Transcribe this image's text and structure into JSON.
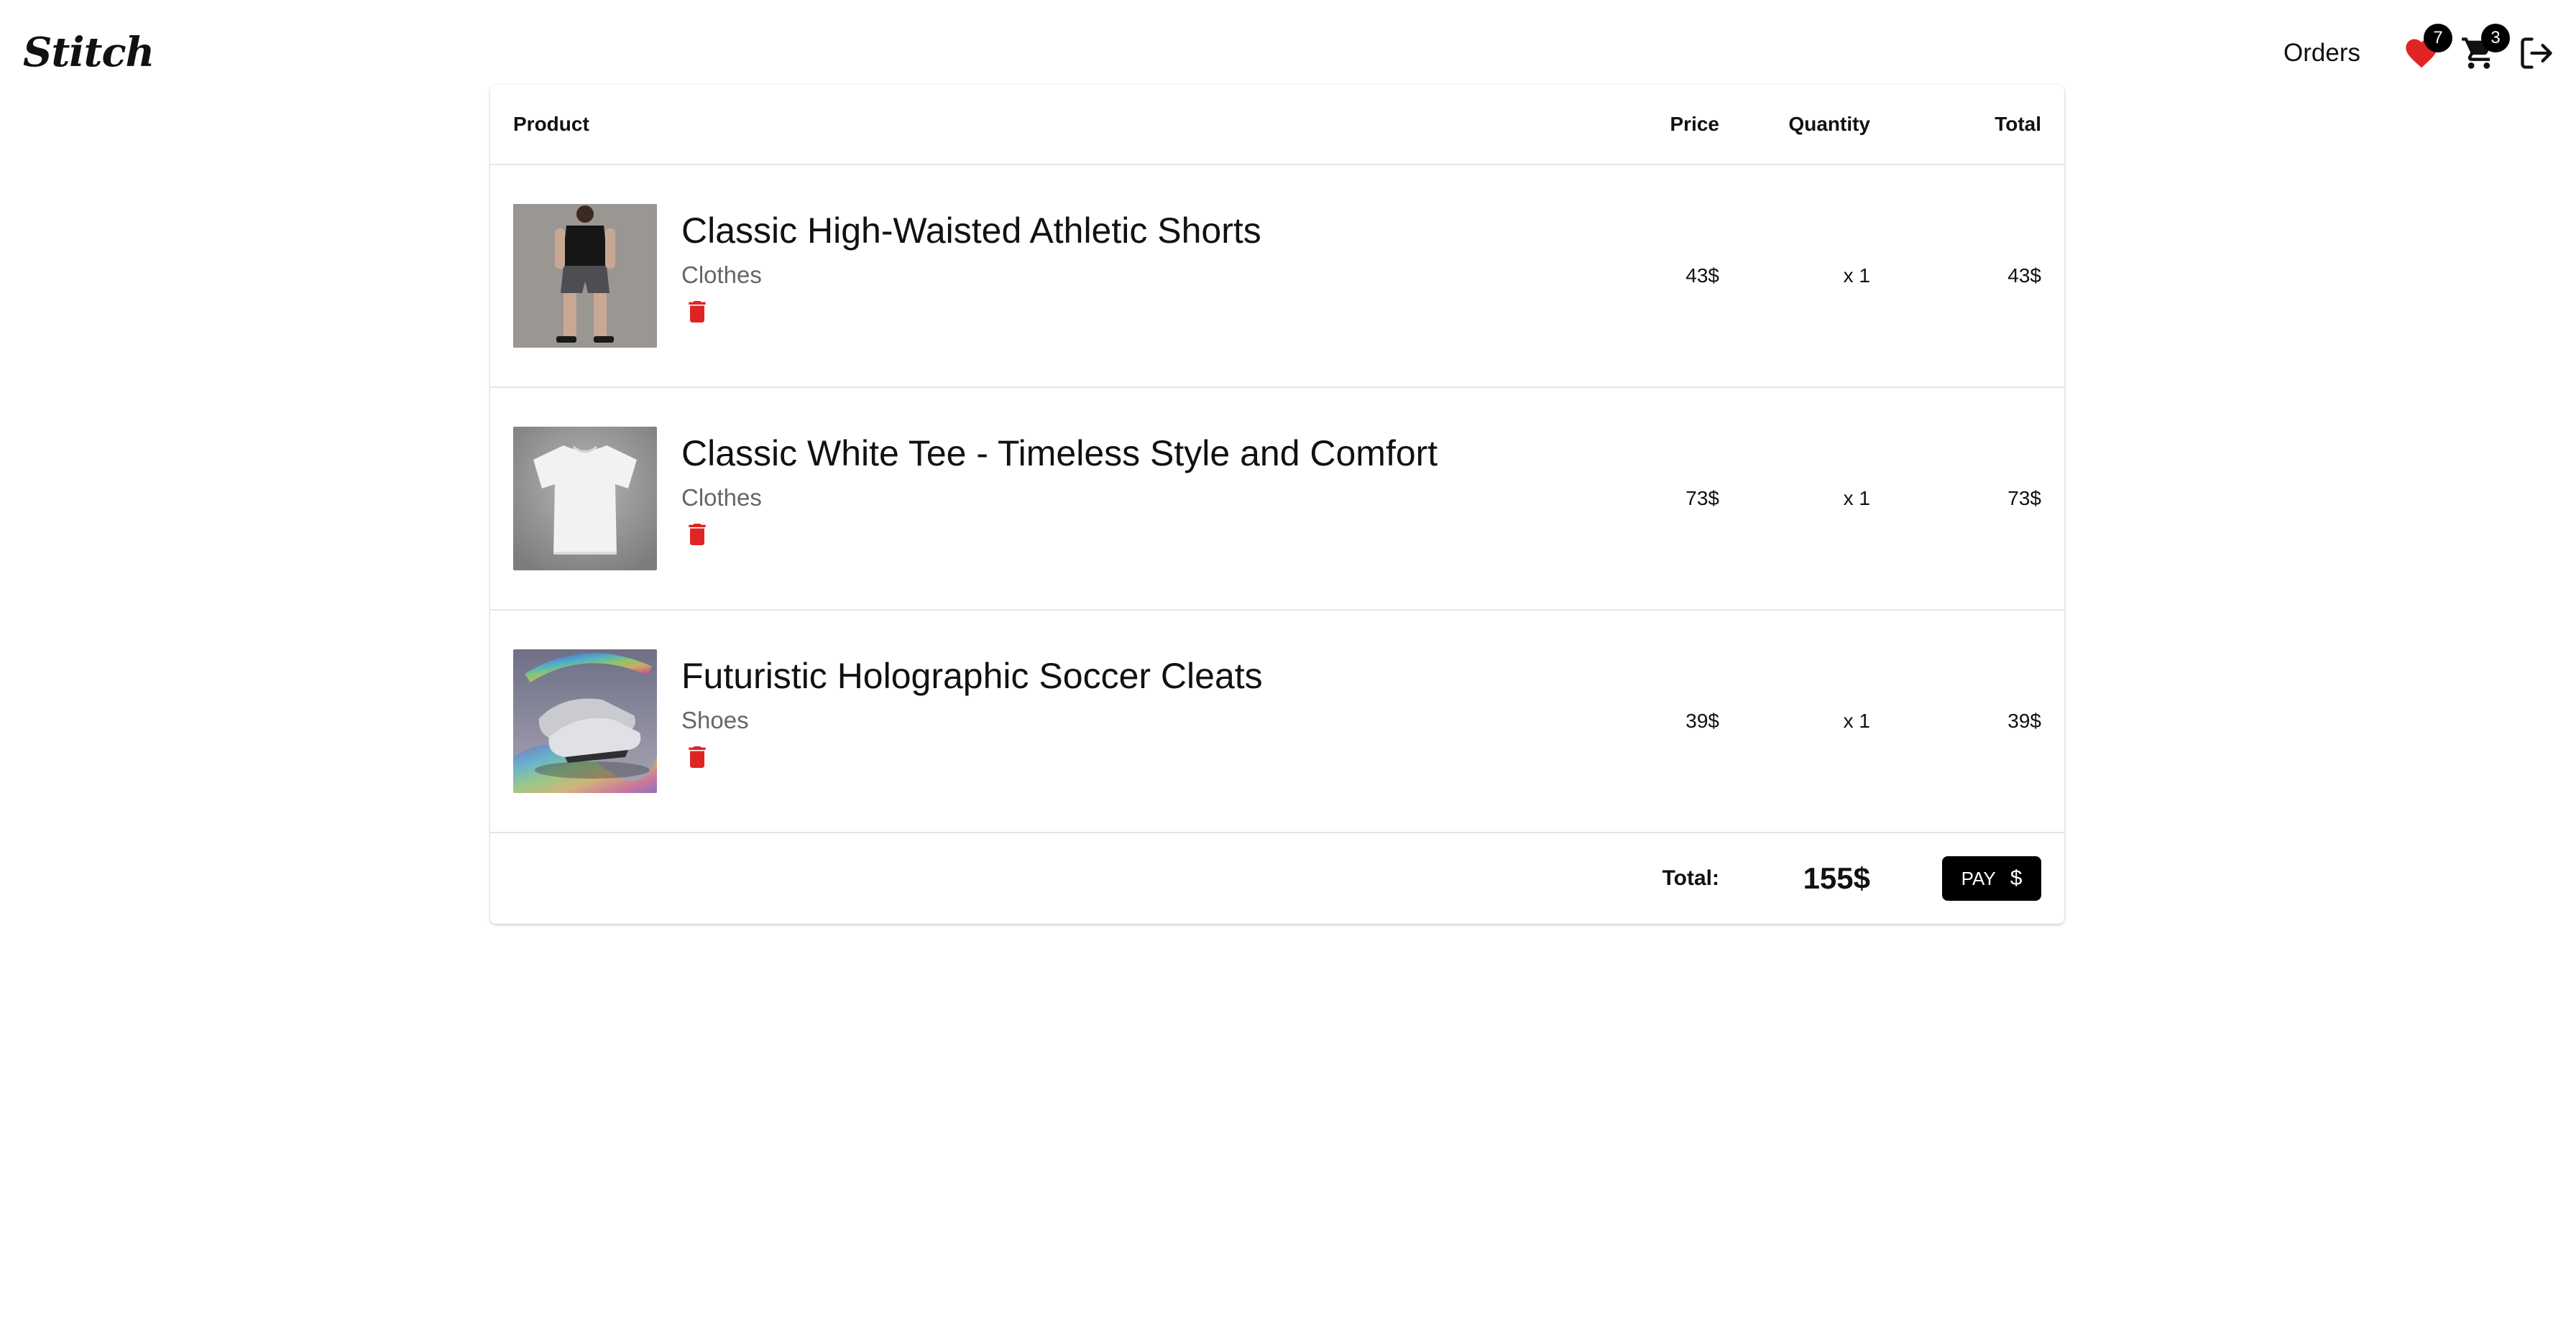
{
  "brand": "Stitch",
  "nav": {
    "orders_label": "Orders",
    "favorites_count": "7",
    "cart_count": "3",
    "accent_heart": "#e02424"
  },
  "table": {
    "headers": {
      "product": "Product",
      "price": "Price",
      "quantity": "Quantity",
      "total": "Total"
    },
    "items": [
      {
        "name": "Classic High-Waisted Athletic Shorts",
        "category": "Clothes",
        "price": "43$",
        "quantity": "x 1",
        "total": "43$",
        "image": "athletic-shorts-photo"
      },
      {
        "name": "Classic White Tee - Timeless Style and Comfort",
        "category": "Clothes",
        "price": "73$",
        "quantity": "x 1",
        "total": "73$",
        "image": "white-tee-photo"
      },
      {
        "name": "Futuristic Holographic Soccer Cleats",
        "category": "Shoes",
        "price": "39$",
        "quantity": "x 1",
        "total": "39$",
        "image": "holographic-cleats-photo"
      }
    ],
    "footer": {
      "total_label": "Total:",
      "total_value": "155$",
      "pay_label": "PAY",
      "pay_icon": "$"
    }
  },
  "colors": {
    "trash": "#e02424",
    "pay_bg": "#000000"
  }
}
